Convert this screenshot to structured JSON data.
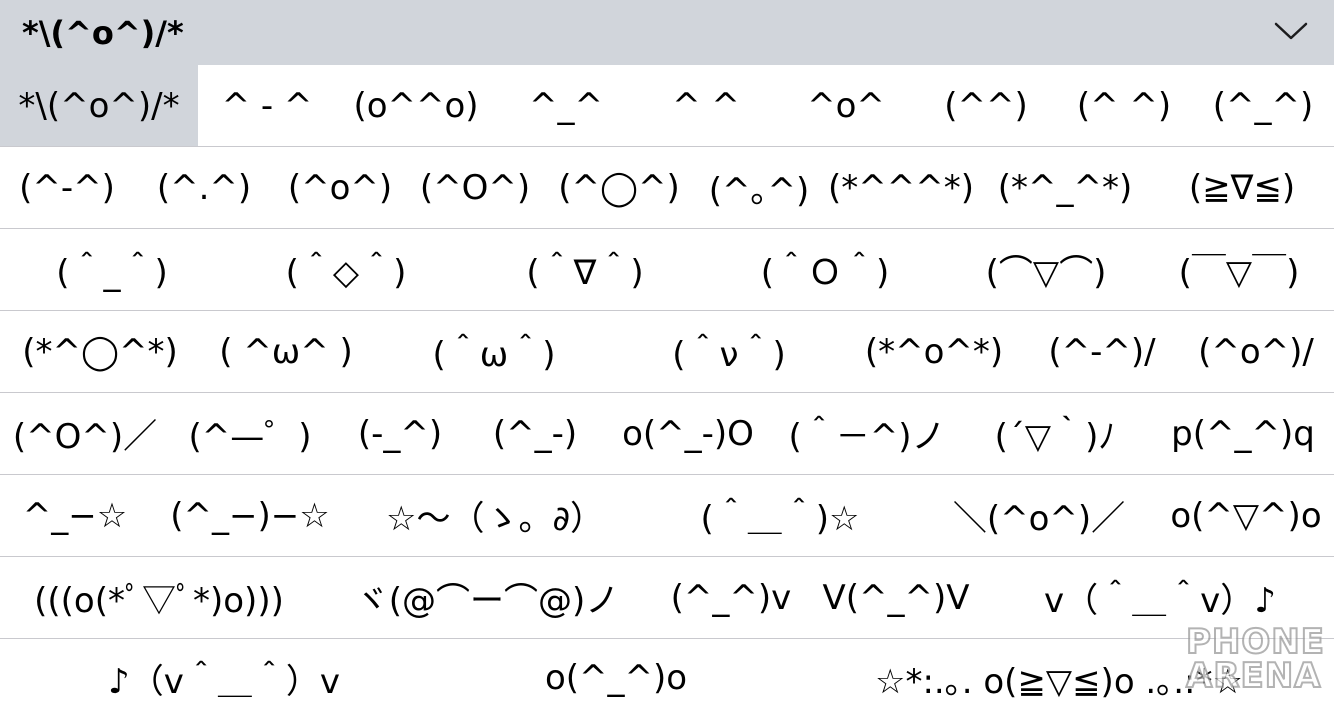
{
  "header": {
    "title": "*\\(^o^)/*",
    "toggle_icon": "chevron-down-icon"
  },
  "rows": [
    [
      "*\\(^o^)/*",
      "^ - ^",
      "(o^^o)",
      "^_^",
      "^ ^",
      "^o^",
      "(^^)",
      "(^ ^)",
      "(^_^)"
    ],
    [
      "(^-^)",
      "(^.^)",
      "(^o^)",
      "(^O^)",
      "(^◯^)",
      "(^｡^)",
      "(*^^^*)",
      "(*^_^*)",
      "(≧∇≦)"
    ],
    [
      "(＾_＾)",
      "(＾◇＾)",
      "(＾∇＾)",
      "(＾Ｏ＾)",
      "(⌒▽⌒)",
      "(￣▽￣)"
    ],
    [
      "(*^◯^*)",
      "( ^ω^ )",
      "(＾ω＾)",
      "(＾ν＾)",
      "(*^o^*)",
      "(^-^)/",
      "(^o^)/"
    ],
    [
      "(^O^)／",
      "(^—゜)",
      "(-_^)",
      "(^_-)",
      "o(^_-)O",
      "(＾－^)ノ",
      "(´▽｀)ﾉ",
      "p(^_^)q"
    ],
    [
      "^_−☆",
      "(^_−)−☆",
      "☆〜（ゝ。∂）",
      "(＾＿＾)☆",
      "＼(^o^)／",
      "o(^▽^)o"
    ],
    [
      "(((o(*ﾟ▽ﾟ*)o)))",
      "ヾ(@⌒ー⌒@)ノ",
      "(^_^)v",
      "V(^_^)V",
      "v（＾＿＾v）♪"
    ],
    [
      "♪（v＾＿＾）v",
      "o(^_^)o",
      "☆*:.｡. o(≧▽≦)o .｡.:*☆"
    ]
  ],
  "selected": "*\\(^o^)/*",
  "watermark": {
    "line1": "PHONE",
    "line2": "ARENA"
  }
}
